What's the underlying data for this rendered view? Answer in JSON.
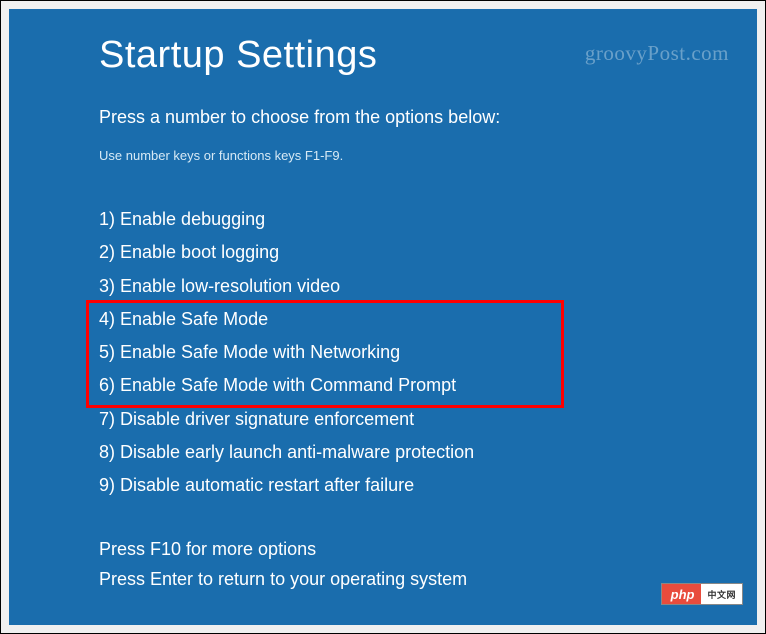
{
  "title": "Startup Settings",
  "subtitle": "Press a number to choose from the options below:",
  "hint": "Use number keys or functions keys F1-F9.",
  "options": [
    "1) Enable debugging",
    "2) Enable boot logging",
    "3) Enable low-resolution video",
    "4) Enable Safe Mode",
    "5) Enable Safe Mode with Networking",
    "6) Enable Safe Mode with Command Prompt",
    "7) Disable driver signature enforcement",
    "8) Disable early launch anti-malware protection",
    "9) Disable automatic restart after failure"
  ],
  "footer": {
    "more": "Press F10 for more options",
    "enter": "Press Enter to return to your operating system"
  },
  "watermark": "groovyPost.com",
  "badge": {
    "left": "php",
    "right": "中文网"
  }
}
